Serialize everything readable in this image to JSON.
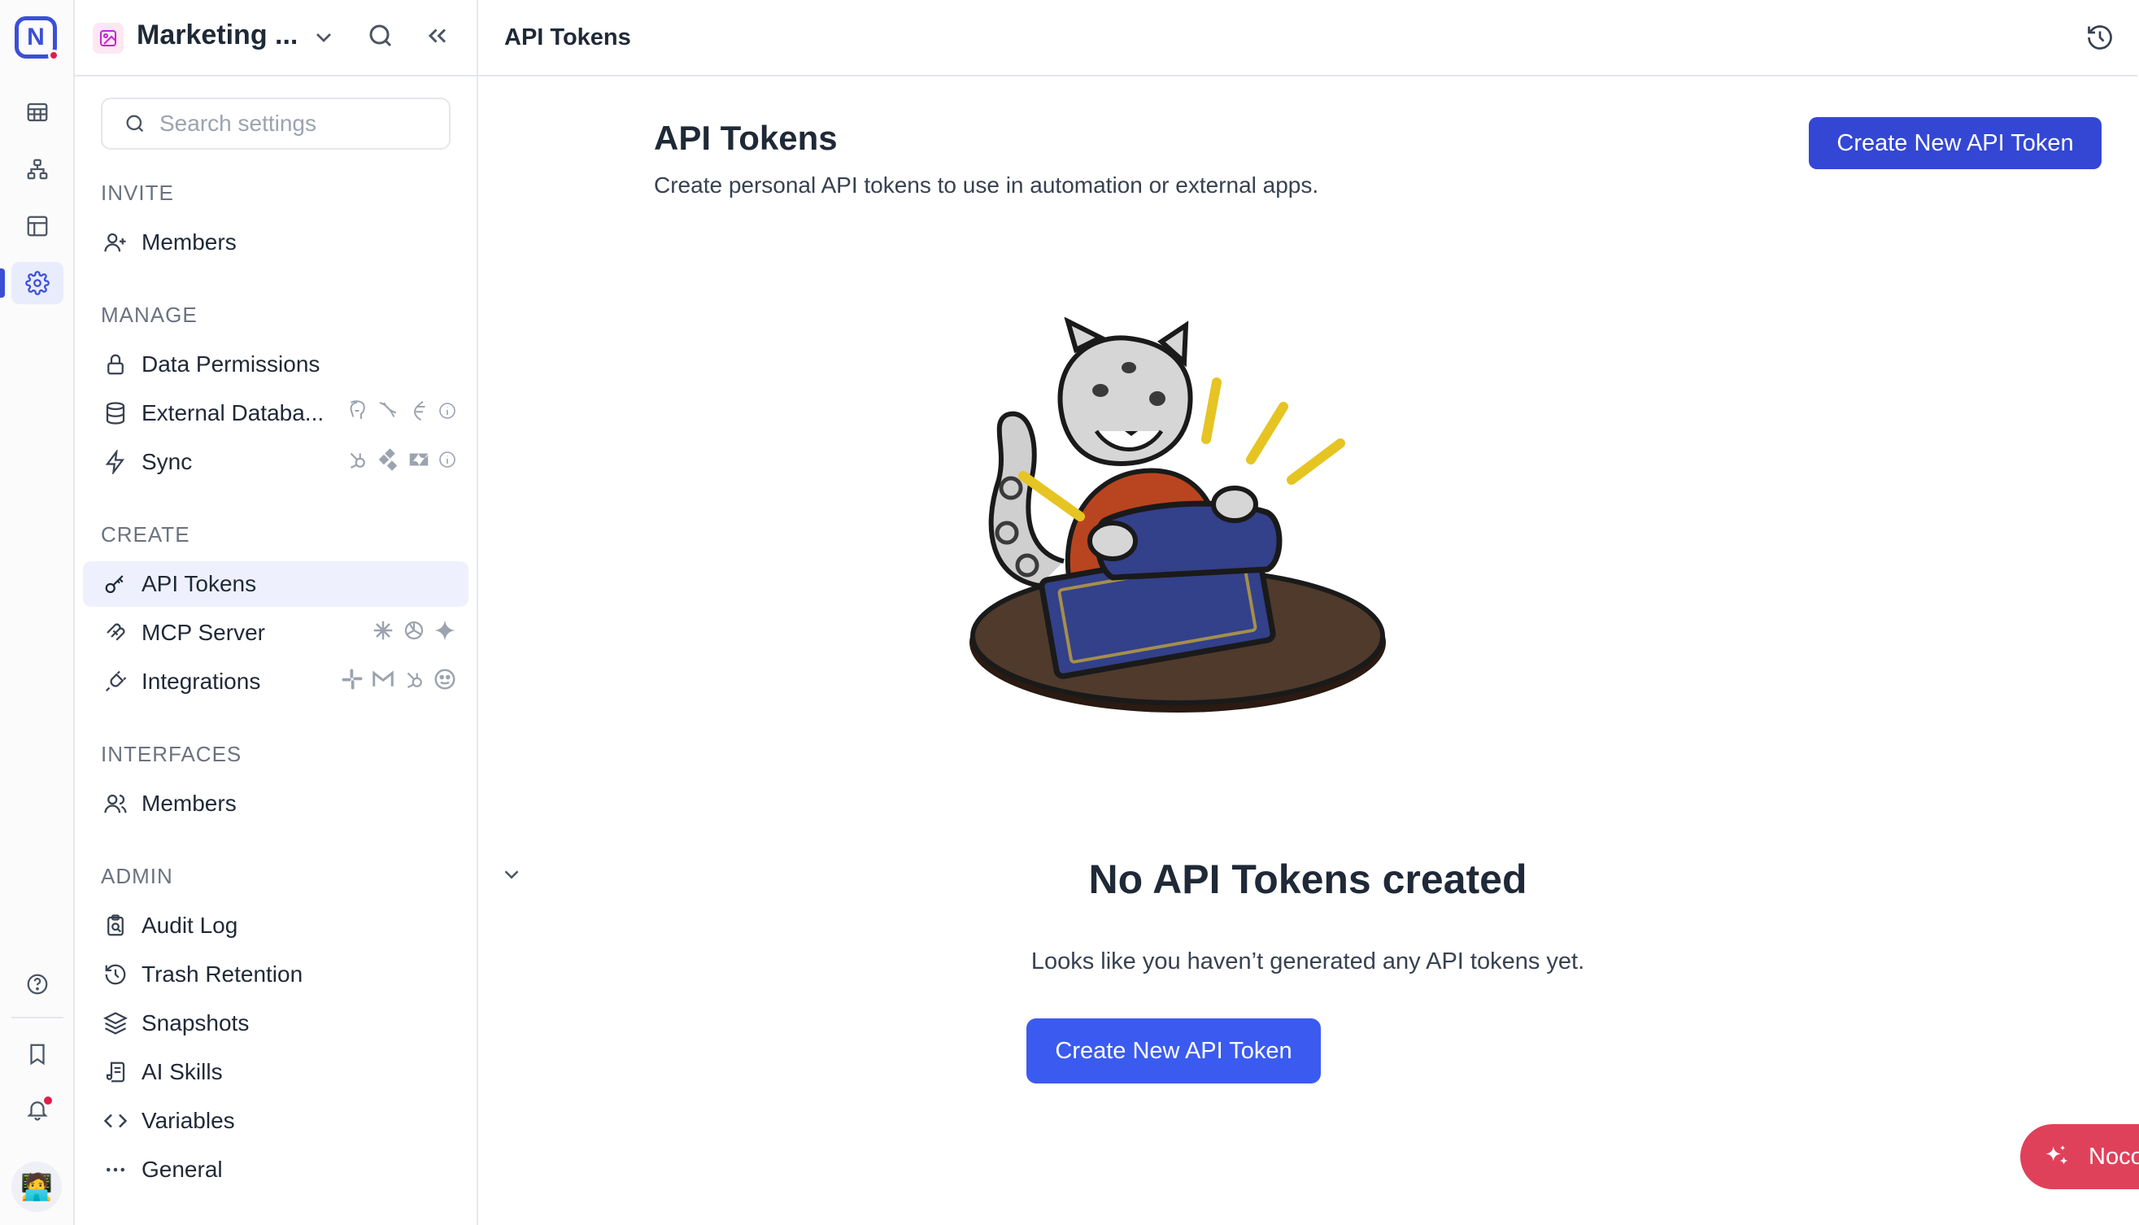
{
  "rail": {
    "logo_letter": "N",
    "accent": "#3b4fd6"
  },
  "workspace": {
    "name": "Marketing ...",
    "search_placeholder": "Search settings"
  },
  "sidebar": {
    "sections": {
      "invite": "INVITE",
      "manage": "MANAGE",
      "create": "CREATE",
      "interfaces": "INTERFACES",
      "admin": "ADMIN"
    },
    "items": {
      "members": "Members",
      "data_permissions": "Data Permissions",
      "external_databases": "External Databa...",
      "sync": "Sync",
      "api_tokens": "API Tokens",
      "mcp_server": "MCP Server",
      "integrations": "Integrations",
      "interfaces_members": "Members",
      "audit_log": "Audit Log",
      "trash_retention": "Trash Retention",
      "snapshots": "Snapshots",
      "ai_skills": "AI Skills",
      "variables": "Variables",
      "general": "General"
    }
  },
  "topbar": {
    "breadcrumb": "API Tokens"
  },
  "main": {
    "title": "API Tokens",
    "subtitle": "Create personal API tokens to use in automation or external apps.",
    "create_button": "Create New API Token",
    "empty_title": "No API Tokens created",
    "empty_subtitle": "Looks like you haven’t generated any API tokens yet.",
    "empty_button": "Create New API Token"
  },
  "assistant": {
    "label": "NocoAI"
  }
}
